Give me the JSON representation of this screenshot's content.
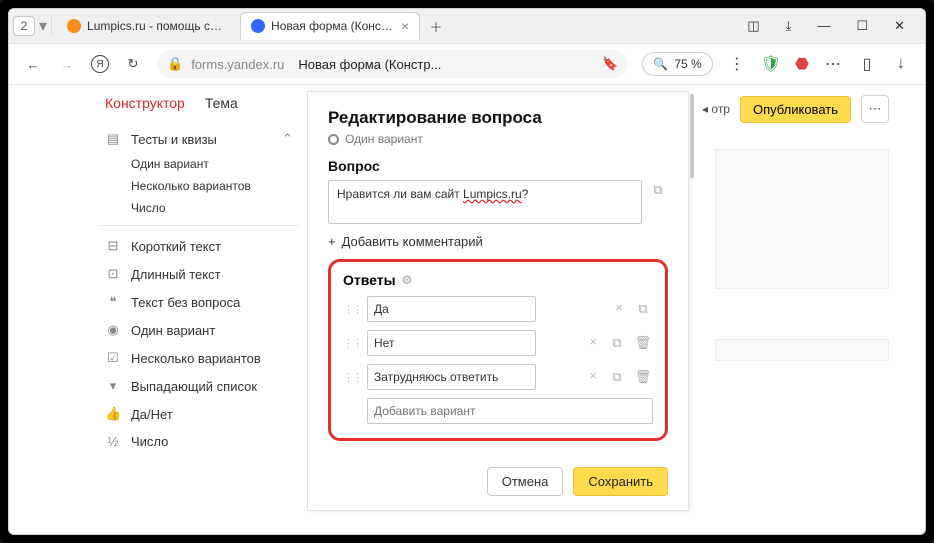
{
  "tabbar": {
    "num": "2",
    "tab1_title": "Lumpics.ru - помощь с ком",
    "tab2_title": "Новая форма (Констру"
  },
  "urlbar": {
    "host": "forms.yandex.ru",
    "title": "Новая форма (Констр...",
    "zoom_icon": "🔍",
    "zoom": "75 %"
  },
  "nav": {
    "constructor": "Конструктор",
    "theme": "Тема"
  },
  "sidebar": {
    "group1": {
      "label": "Тесты и квизы"
    },
    "sub": {
      "one": "Один вариант",
      "many": "Несколько вариантов",
      "number": "Число"
    },
    "items": {
      "short_text": "Короткий текст",
      "long_text": "Длинный текст",
      "text_no_q": "Текст без вопроса",
      "one_option": "Один вариант",
      "many_options": "Несколько вариантов",
      "dropdown": "Выпадающий список",
      "yes_no": "Да/Нет",
      "number": "Число"
    }
  },
  "topright": {
    "preview_fragment": "◂ отр",
    "publish": "Опубликовать"
  },
  "panel": {
    "title": "Редактирование вопроса",
    "qtype": "Один вариант",
    "question_label": "Вопрос",
    "question_pre": "Нравится ли вам сайт ",
    "question_underlined": "Lumpics.ru",
    "question_post": "?",
    "add_comment": "Добавить комментарий",
    "answers_label": "Ответы",
    "answers": {
      "a1": "Да",
      "a2": "Нет",
      "a3": "Затрудняюсь ответить"
    },
    "add_option_placeholder": "Добавить вариант",
    "cancel": "Отмена",
    "save": "Сохранить"
  }
}
